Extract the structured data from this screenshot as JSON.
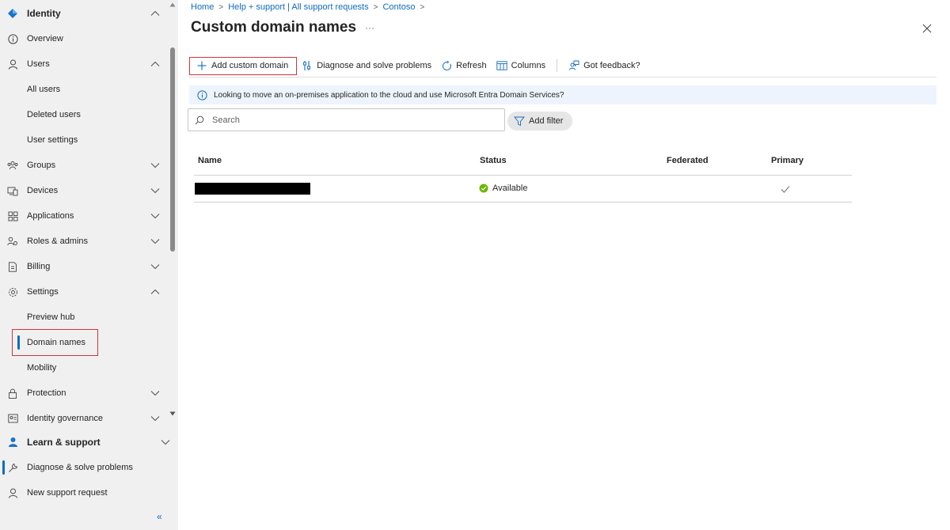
{
  "sidebar": {
    "items": [
      {
        "label": "Identity",
        "icon": "identity-diamond-icon",
        "chevron": "up"
      },
      {
        "label": "Overview",
        "icon": "info-icon"
      },
      {
        "label": "Users",
        "icon": "user-icon",
        "chevron": "up"
      },
      {
        "label": "All users"
      },
      {
        "label": "Deleted users"
      },
      {
        "label": "User settings"
      },
      {
        "label": "Groups",
        "icon": "groups-icon",
        "chevron": "down"
      },
      {
        "label": "Devices",
        "icon": "devices-icon",
        "chevron": "down"
      },
      {
        "label": "Applications",
        "icon": "applications-icon",
        "chevron": "down"
      },
      {
        "label": "Roles & admins",
        "icon": "roles-icon",
        "chevron": "down"
      },
      {
        "label": "Billing",
        "icon": "billing-icon",
        "chevron": "down"
      },
      {
        "label": "Settings",
        "icon": "gear-icon",
        "chevron": "up"
      },
      {
        "label": "Preview hub"
      },
      {
        "label": "Domain names",
        "selected": true
      },
      {
        "label": "Mobility"
      },
      {
        "label": "Protection",
        "icon": "lock-icon",
        "chevron": "down"
      },
      {
        "label": "Identity governance",
        "icon": "governance-icon",
        "chevron": "down"
      }
    ],
    "bottom": [
      {
        "label": "Learn & support",
        "icon": "learn-support-icon",
        "chevron": "down"
      },
      {
        "label": "Diagnose & solve problems",
        "icon": "wrench-icon",
        "selected": true
      },
      {
        "label": "New support request",
        "icon": "support-person-icon"
      }
    ],
    "collapse_label": "«"
  },
  "breadcrumb": [
    "Home",
    "Help + support | All support requests",
    "Contoso"
  ],
  "page": {
    "title": "Custom domain names",
    "more": "···"
  },
  "toolbar": {
    "add": "Add custom domain",
    "diagnose": "Diagnose and solve problems",
    "refresh": "Refresh",
    "columns": "Columns",
    "feedback": "Got feedback?"
  },
  "info_banner": "Looking to move an on-premises application to the cloud and use Microsoft Entra Domain Services?",
  "search": {
    "placeholder": "Search"
  },
  "filter": {
    "label": "Add filter"
  },
  "table": {
    "columns": [
      "Name",
      "Status",
      "Federated",
      "Primary"
    ],
    "rows": [
      {
        "name": "",
        "name_redacted": true,
        "status": "Available",
        "federated": "",
        "primary": true
      }
    ]
  },
  "colors": {
    "accent": "#0f6cbd",
    "highlight_box": "#d13438",
    "status_available": "#6bb700"
  }
}
